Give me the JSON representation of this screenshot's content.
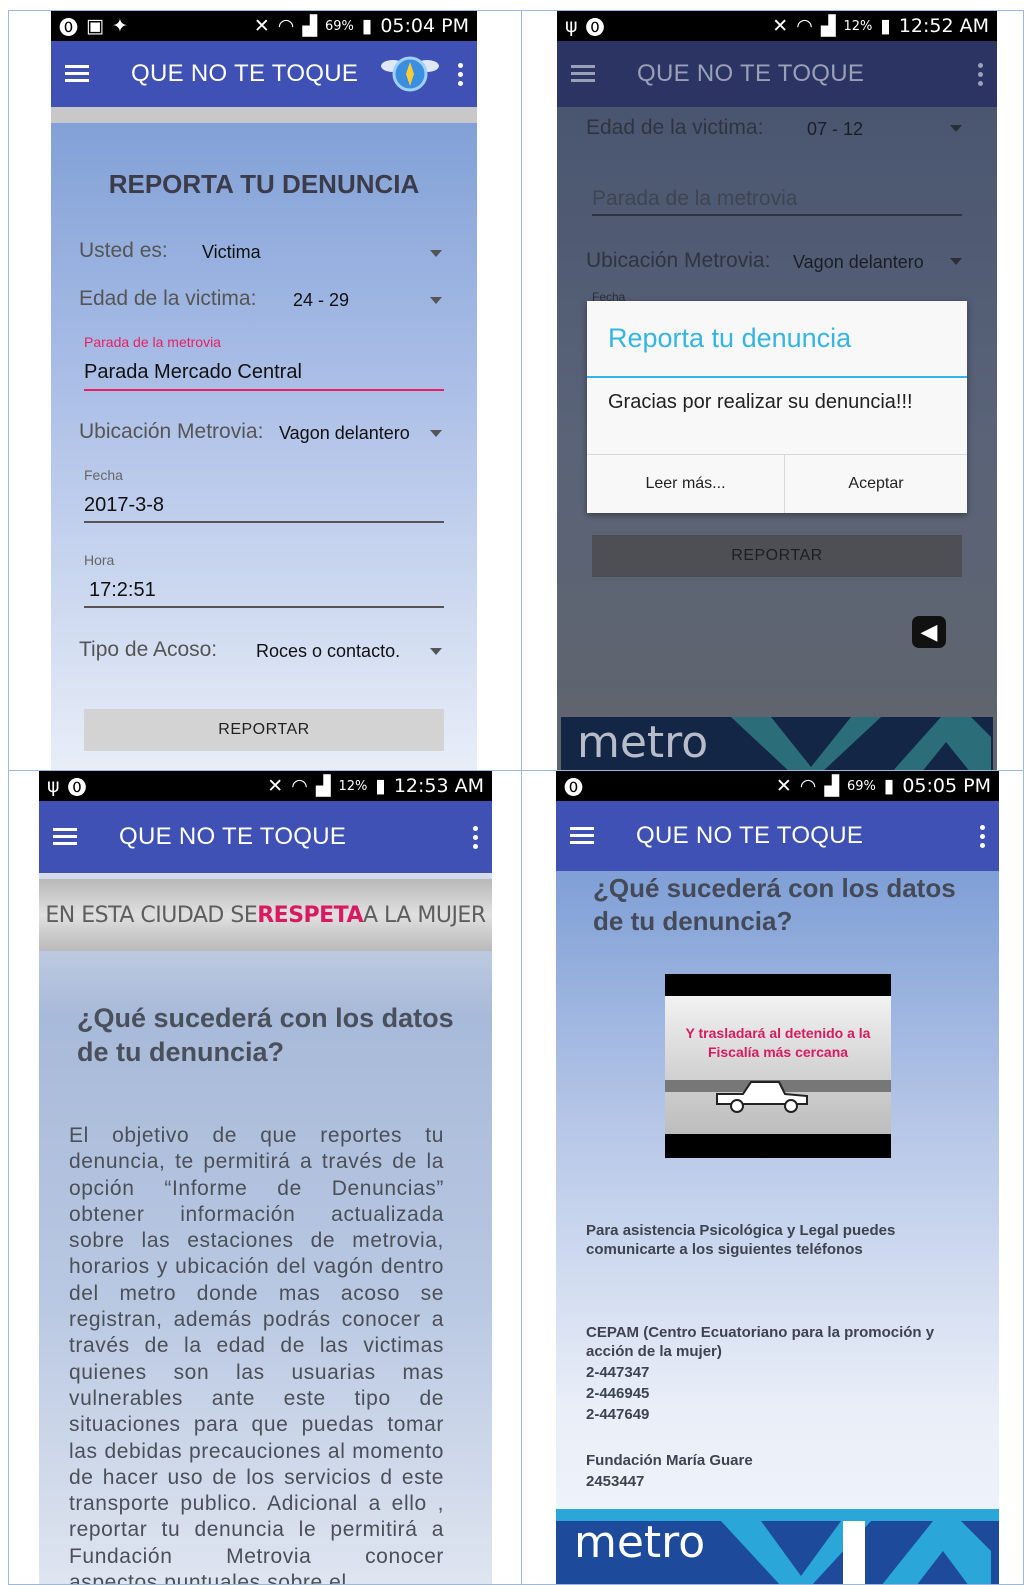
{
  "app_title": "QUE NO TE TOQUE",
  "screen1": {
    "status": {
      "battery": "69%",
      "time": "05:04 PM"
    },
    "heading": "REPORTA TU DENUNCIA",
    "usted_es_label": "Usted es:",
    "usted_es_value": "Victima",
    "edad_label": "Edad de la victima:",
    "edad_value": "24 - 29",
    "parada_label": "Parada de la metrovia",
    "parada_value": "Parada Mercado Central",
    "ubicacion_label": "Ubicación Metrovia:",
    "ubicacion_value": "Vagon delantero",
    "fecha_label": "Fecha",
    "fecha_value": "2017-3-8",
    "hora_label": "Hora",
    "hora_value": "17:2:51",
    "tipo_label": "Tipo de Acoso:",
    "tipo_value": "Roces o contacto.",
    "reportar_button": "REPORTAR"
  },
  "screen2": {
    "status": {
      "battery": "12%",
      "time": "12:52 AM"
    },
    "edad_label": "Edad de la victima:",
    "edad_value": "07 - 12",
    "parada_placeholder": "Parada de la metrovia",
    "ubicacion_label": "Ubicación Metrovia:",
    "ubicacion_value": "Vagon delantero",
    "fecha_label": "Fecha",
    "dialog_title": "Reporta tu denuncia",
    "dialog_message": "Gracias por realizar su denuncia!!!",
    "dialog_button_more": "Leer más...",
    "dialog_button_accept": "Aceptar",
    "reportar_button": "REPORTAR",
    "banner_text": "metro"
  },
  "screen3": {
    "status": {
      "battery": "12%",
      "time": "12:53 AM"
    },
    "banner": {
      "part1": "EN ESTA CIUDAD SE ",
      "highlight": "RESPETA",
      "part2": " A LA MUJER"
    },
    "heading": "¿Qué sucederá con los datos de tu denuncia?",
    "body": "El objetivo de que reportes tu denuncia, te permitirá a través de la opción “Informe de Denuncias” obtener información actualizada sobre las estaciones de metrovia, horarios y ubicación del vagón dentro del metro donde mas acoso se registran, además podrás conocer a través de la edad de las victimas quienes son las usuarias mas vulnerables ante este tipo de situaciones para que puedas tomar las debidas precauciones al momento de hacer uso de los servicios d este transporte publico. Adicional a ello , reportar tu denuncia le permitirá a Fundación Metrovia conocer aspectos puntuales sobre el"
  },
  "screen4": {
    "status": {
      "battery": "69%",
      "time": "05:05 PM"
    },
    "heading": "¿Qué sucederá con los datos de tu denuncia?",
    "video_caption": "Y trasladará al detenido a la Fiscalía más cercana",
    "assist_text": "Para asistencia Psicológica y Legal puedes comunicarte a los siguientes teléfonos",
    "cepam_name": "CEPAM (Centro Ecuatoriano para la promoción y acción de la mujer)",
    "cepam_phones": [
      "2-447347",
      "2-446945",
      "2-447649"
    ],
    "fundacion_name": "Fundación María Guare",
    "fundacion_phone": "2453447",
    "banner_text": "metro"
  },
  "colors": {
    "appbar": "#3f51b5",
    "accent_pink": "#e91e63",
    "dialog_teal": "#33b5e5"
  }
}
